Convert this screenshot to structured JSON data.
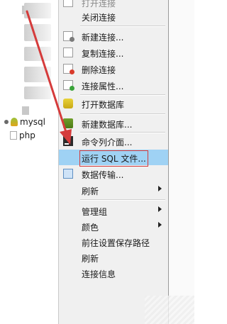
{
  "tree": {
    "nodes": [
      {
        "label": "mysql"
      },
      {
        "label": "php"
      }
    ]
  },
  "menu": {
    "items": [
      {
        "label": "打开连接",
        "faded": true
      },
      {
        "label": "关闭连接"
      },
      {
        "label": "新建连接..."
      },
      {
        "label": "复制连接..."
      },
      {
        "label": "删除连接"
      },
      {
        "label": "连接属性..."
      },
      {
        "label": "打开数据库"
      },
      {
        "label": "新建数据库..."
      },
      {
        "label": "命令列介面..."
      },
      {
        "label": "运行 SQL 文件..."
      },
      {
        "label": "数据传输..."
      },
      {
        "label": "刷新"
      },
      {
        "label": "管理组"
      },
      {
        "label": "颜色"
      },
      {
        "label": "前往设置保存路径"
      },
      {
        "label": "刷新"
      },
      {
        "label": "连接信息"
      }
    ]
  },
  "colors": {
    "highlight": "#9fd2f4",
    "annotation": "#d53b3b",
    "menu_bg": "#f0f0f0"
  }
}
